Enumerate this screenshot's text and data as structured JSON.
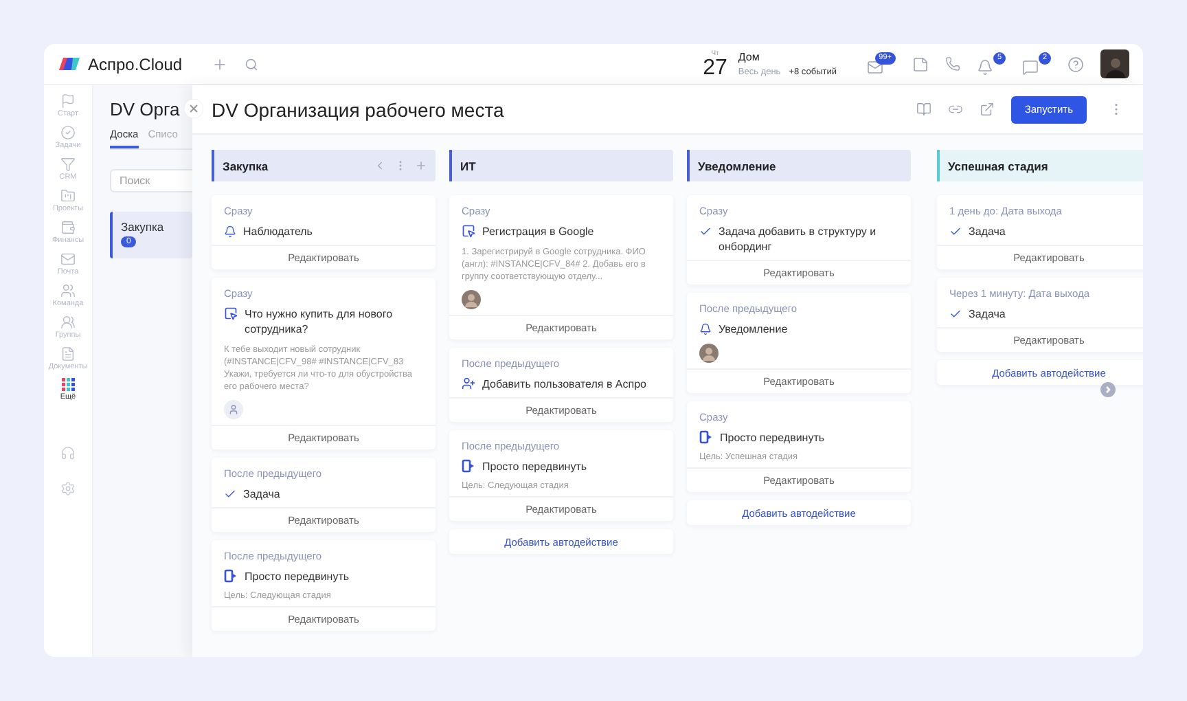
{
  "topbar": {
    "logo": "Аспро.Cloud",
    "calendar": {
      "weekday": "Чт",
      "day": "27",
      "event": "Дом",
      "event_time": "Весь день",
      "more": "+8 событий"
    },
    "badges": {
      "mail": "99+",
      "bell": "5",
      "chat": "2"
    }
  },
  "nav": {
    "items": [
      {
        "label": "Старт",
        "selected": false
      },
      {
        "label": "Задачи",
        "selected": false
      },
      {
        "label": "CRM",
        "selected": false
      },
      {
        "label": "Проекты",
        "selected": false
      },
      {
        "label": "Финансы",
        "selected": false
      },
      {
        "label": "Почта",
        "selected": false
      },
      {
        "label": "Команда",
        "selected": false
      },
      {
        "label": "Группы",
        "selected": false
      },
      {
        "label": "Документы",
        "selected": false
      },
      {
        "label": "Ещё",
        "selected": true
      }
    ]
  },
  "background_page": {
    "title": "DV Орга",
    "tabs": [
      {
        "label": "Доска",
        "selected": true
      },
      {
        "label": "Списо",
        "selected": false
      }
    ],
    "search": {
      "placeholder": "Поиск"
    },
    "stage": {
      "name": "Закупка",
      "count": "0"
    }
  },
  "panel": {
    "title": "DV Организация рабочего места",
    "launch_button": "Запустить",
    "columns": [
      {
        "name": "Закупка",
        "color": "#4a5fd0",
        "controls": true,
        "cards": [
          {
            "trigger": "Сразу",
            "kind": "bell",
            "title": "Наблюдатель",
            "edit": "Редактировать"
          },
          {
            "trigger": "Сразу",
            "kind": "form",
            "title": "Что нужно купить для нового сотрудника?",
            "description": "К тебе выходит новый сотрудник (#INSTANCE|CFV_98# #INSTANCE|CFV_83 Укажи, требуется ли что-то для обустройства его рабочего места?",
            "avatar": {
              "kind": "placeholder"
            },
            "edit": "Редактировать"
          },
          {
            "trigger": "После предыдущего",
            "kind": "check",
            "title": "Задача",
            "edit": "Редактировать"
          },
          {
            "trigger": "После предыдущего",
            "kind": "move",
            "title": "Просто передвинуть",
            "target": "Цель: Следующая стадия",
            "edit": "Редактировать"
          }
        ]
      },
      {
        "name": "ИТ",
        "color": "#4a5fd0",
        "controls": false,
        "cards": [
          {
            "trigger": "Сразу",
            "kind": "form",
            "title": "Регистрация в Google",
            "description": "1. Зарегистрируй в Google сотрудника. ФИО (англ): #INSTANCE|CFV_84# 2. Добавь его в группу соответствующую отделу...",
            "avatar": {
              "kind": "photo"
            },
            "edit": "Редактировать"
          },
          {
            "trigger": "После предыдущего",
            "kind": "user-add",
            "title": "Добавить пользователя в Аспро",
            "edit": "Редактировать"
          },
          {
            "trigger": "После предыдущего",
            "kind": "move",
            "title": "Просто передвинуть",
            "target": "Цель: Следующая стадия",
            "edit": "Редактировать"
          }
        ],
        "add": "Добавить автодействие"
      },
      {
        "name": "Уведомление",
        "color": "#4a5fd0",
        "controls": false,
        "cards": [
          {
            "trigger": "Сразу",
            "kind": "check",
            "title": "Задача добавить в структуру и онбординг",
            "edit": "Редактировать"
          },
          {
            "trigger": "После предыдущего",
            "kind": "bell",
            "title": "Уведомление",
            "avatar": {
              "kind": "photo"
            },
            "edit": "Редактировать"
          },
          {
            "trigger": "Сразу",
            "kind": "move",
            "title": "Просто передвинуть",
            "target": "Цель: Успешная стадия",
            "edit": "Редактировать"
          }
        ],
        "add": "Добавить автодействие"
      },
      {
        "name": "Успешная стадия",
        "color": "#5cc8cf",
        "controls": false,
        "cards": [
          {
            "trigger": "1 день до: Дата выхода",
            "kind": "check",
            "title": "Задача",
            "edit": "Редактировать"
          },
          {
            "trigger": "Через 1 минуту: Дата выхода",
            "kind": "check",
            "title": "Задача",
            "edit": "Редактировать"
          }
        ],
        "add": "Добавить автодействие"
      }
    ]
  }
}
